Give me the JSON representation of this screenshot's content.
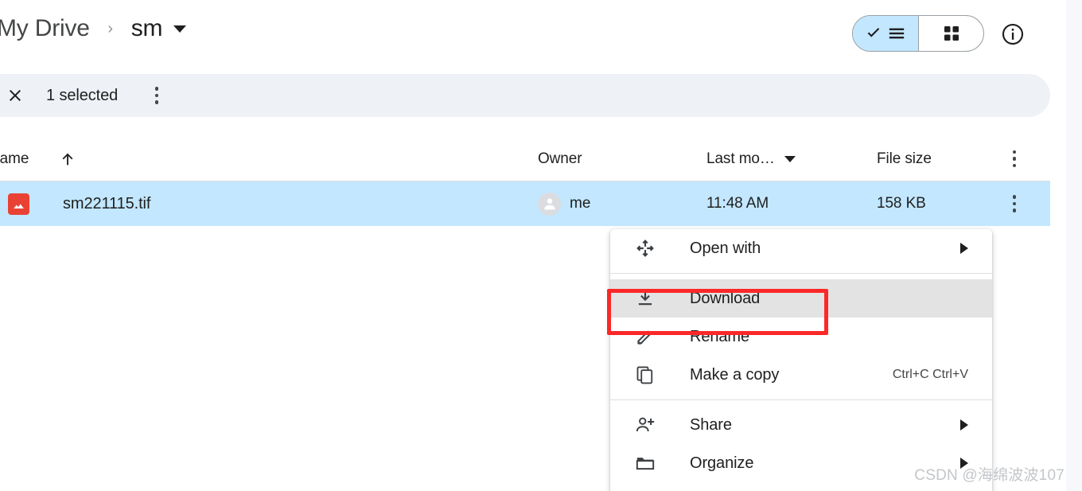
{
  "breadcrumb": {
    "root": "My Drive",
    "separator": "›",
    "current": "sm",
    "caret_icon": "chevron-down-icon"
  },
  "toolbar": {
    "view_toggle": {
      "list_label": "list-view",
      "grid_label": "grid-view",
      "selected": "list-view"
    },
    "info_label": "info-icon"
  },
  "selection_bar": {
    "close_label": "close-icon",
    "count_text": "1 selected",
    "more_label": "more-options-icon",
    "background": "#eef1f6"
  },
  "table": {
    "columns": [
      {
        "label": "Name",
        "sort": "ascending",
        "sort_icon": "arrow-up-icon"
      },
      {
        "label": "Owner"
      },
      {
        "label": "Last mo…",
        "caret_icon": "chevron-down-icon"
      },
      {
        "label": "File size"
      }
    ],
    "header_more_label": "more-options-icon",
    "rows": [
      {
        "icon": "image-file-icon",
        "icon_color": "#e94235",
        "name": "sm221115.tif",
        "owner": "me",
        "owner_avatar": "person-avatar-icon",
        "last_modified": "11:48 AM",
        "file_size": "158 KB",
        "selected": true,
        "selection_color": "#c2e7ff",
        "more_label": "more-options-icon"
      }
    ]
  },
  "context_menu": {
    "highlight_color": "#e3e3e3",
    "items": [
      {
        "icon": "move-arrows-icon",
        "label": "Open with",
        "submenu": true,
        "shortcut": "",
        "highlighted": false,
        "divider_after": true
      },
      {
        "icon": "download-icon",
        "label": "Download",
        "submenu": false,
        "shortcut": "",
        "highlighted": true,
        "divider_after": false
      },
      {
        "icon": "pencil-icon",
        "label": "Rename",
        "submenu": false,
        "shortcut": "",
        "highlighted": false,
        "divider_after": false
      },
      {
        "icon": "copy-icon",
        "label": "Make a copy",
        "submenu": false,
        "shortcut": "Ctrl+C Ctrl+V",
        "highlighted": false,
        "divider_after": true
      },
      {
        "icon": "person-add-icon",
        "label": "Share",
        "submenu": true,
        "shortcut": "",
        "highlighted": false,
        "divider_after": false
      },
      {
        "icon": "folder-icon",
        "label": "Organize",
        "submenu": true,
        "shortcut": "",
        "highlighted": false,
        "divider_after": false
      }
    ]
  },
  "annotation": {
    "target": "Download",
    "color": "#fc2828"
  },
  "watermark": {
    "text": "CSDN @海绵波波107"
  }
}
